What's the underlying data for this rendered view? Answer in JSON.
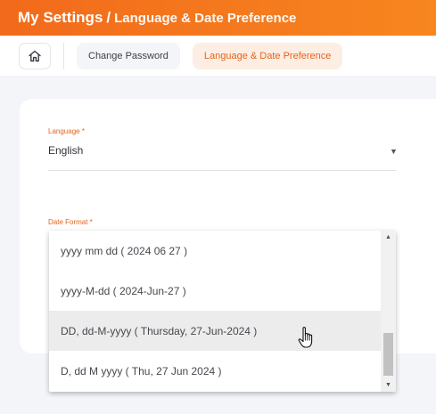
{
  "header": {
    "title": "My Settings",
    "separator": "/",
    "subtitle": "Language & Date Preference"
  },
  "subnav": {
    "home_icon": "home-icon",
    "tabs": [
      {
        "label": "Change Password",
        "active": false
      },
      {
        "label": "Language & Date Preference",
        "active": true
      }
    ]
  },
  "form": {
    "language": {
      "label": "Language *",
      "value": "English"
    },
    "date_format": {
      "label": "Date Format *"
    }
  },
  "date_format_options": [
    {
      "label": "yyyy mm dd ( 2024 06 27 )"
    },
    {
      "label": "yyyy-M-dd ( 2024-Jun-27 )"
    },
    {
      "label": "DD, dd-M-yyyy ( Thursday, 27-Jun-2024 )",
      "hovered": true
    },
    {
      "label": "D, dd M yyyy ( Thu, 27 Jun 2024 )"
    }
  ],
  "colors": {
    "accent": "#f26a1b",
    "active_tab_bg": "#fdeee3",
    "hover_bg": "#ececec"
  }
}
